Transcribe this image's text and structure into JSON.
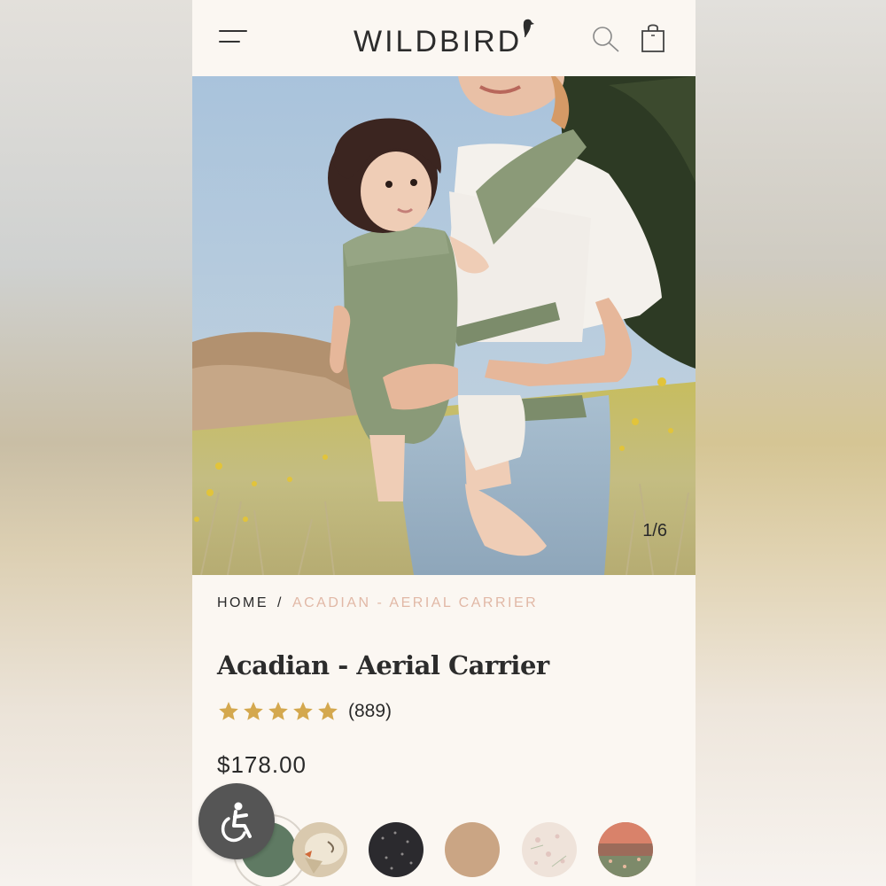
{
  "header": {
    "logo_text": "WILDBIRD",
    "menu_icon": "hamburger-menu-icon",
    "search_icon": "search-icon",
    "cart_icon": "shopping-bag-icon"
  },
  "gallery": {
    "counter": "1/6"
  },
  "breadcrumb": {
    "home": "HOME",
    "separator": "/",
    "current": "ACADIAN - AERIAL CARRIER"
  },
  "product": {
    "title": "Acadian - Aerial Carrier",
    "rating_stars": 5,
    "review_count": "(889)",
    "price": "$178.00"
  },
  "swatches": [
    {
      "name": "sage-green",
      "color": "#5f7a63",
      "selected": true
    },
    {
      "name": "bird-print",
      "color": "#d9c9ae"
    },
    {
      "name": "charcoal-dandelion",
      "color": "#2b2a2e"
    },
    {
      "name": "tan",
      "color": "#caa584"
    },
    {
      "name": "floral-cream",
      "color": "#efe3da"
    },
    {
      "name": "sunset-meadow",
      "color": "#b8705c"
    }
  ],
  "accessibility": {
    "icon": "accessibility-icon"
  },
  "colors": {
    "accent_breadcrumb": "#e1b8a6",
    "star": "#d4a84e",
    "background": "#fbf7f2"
  }
}
